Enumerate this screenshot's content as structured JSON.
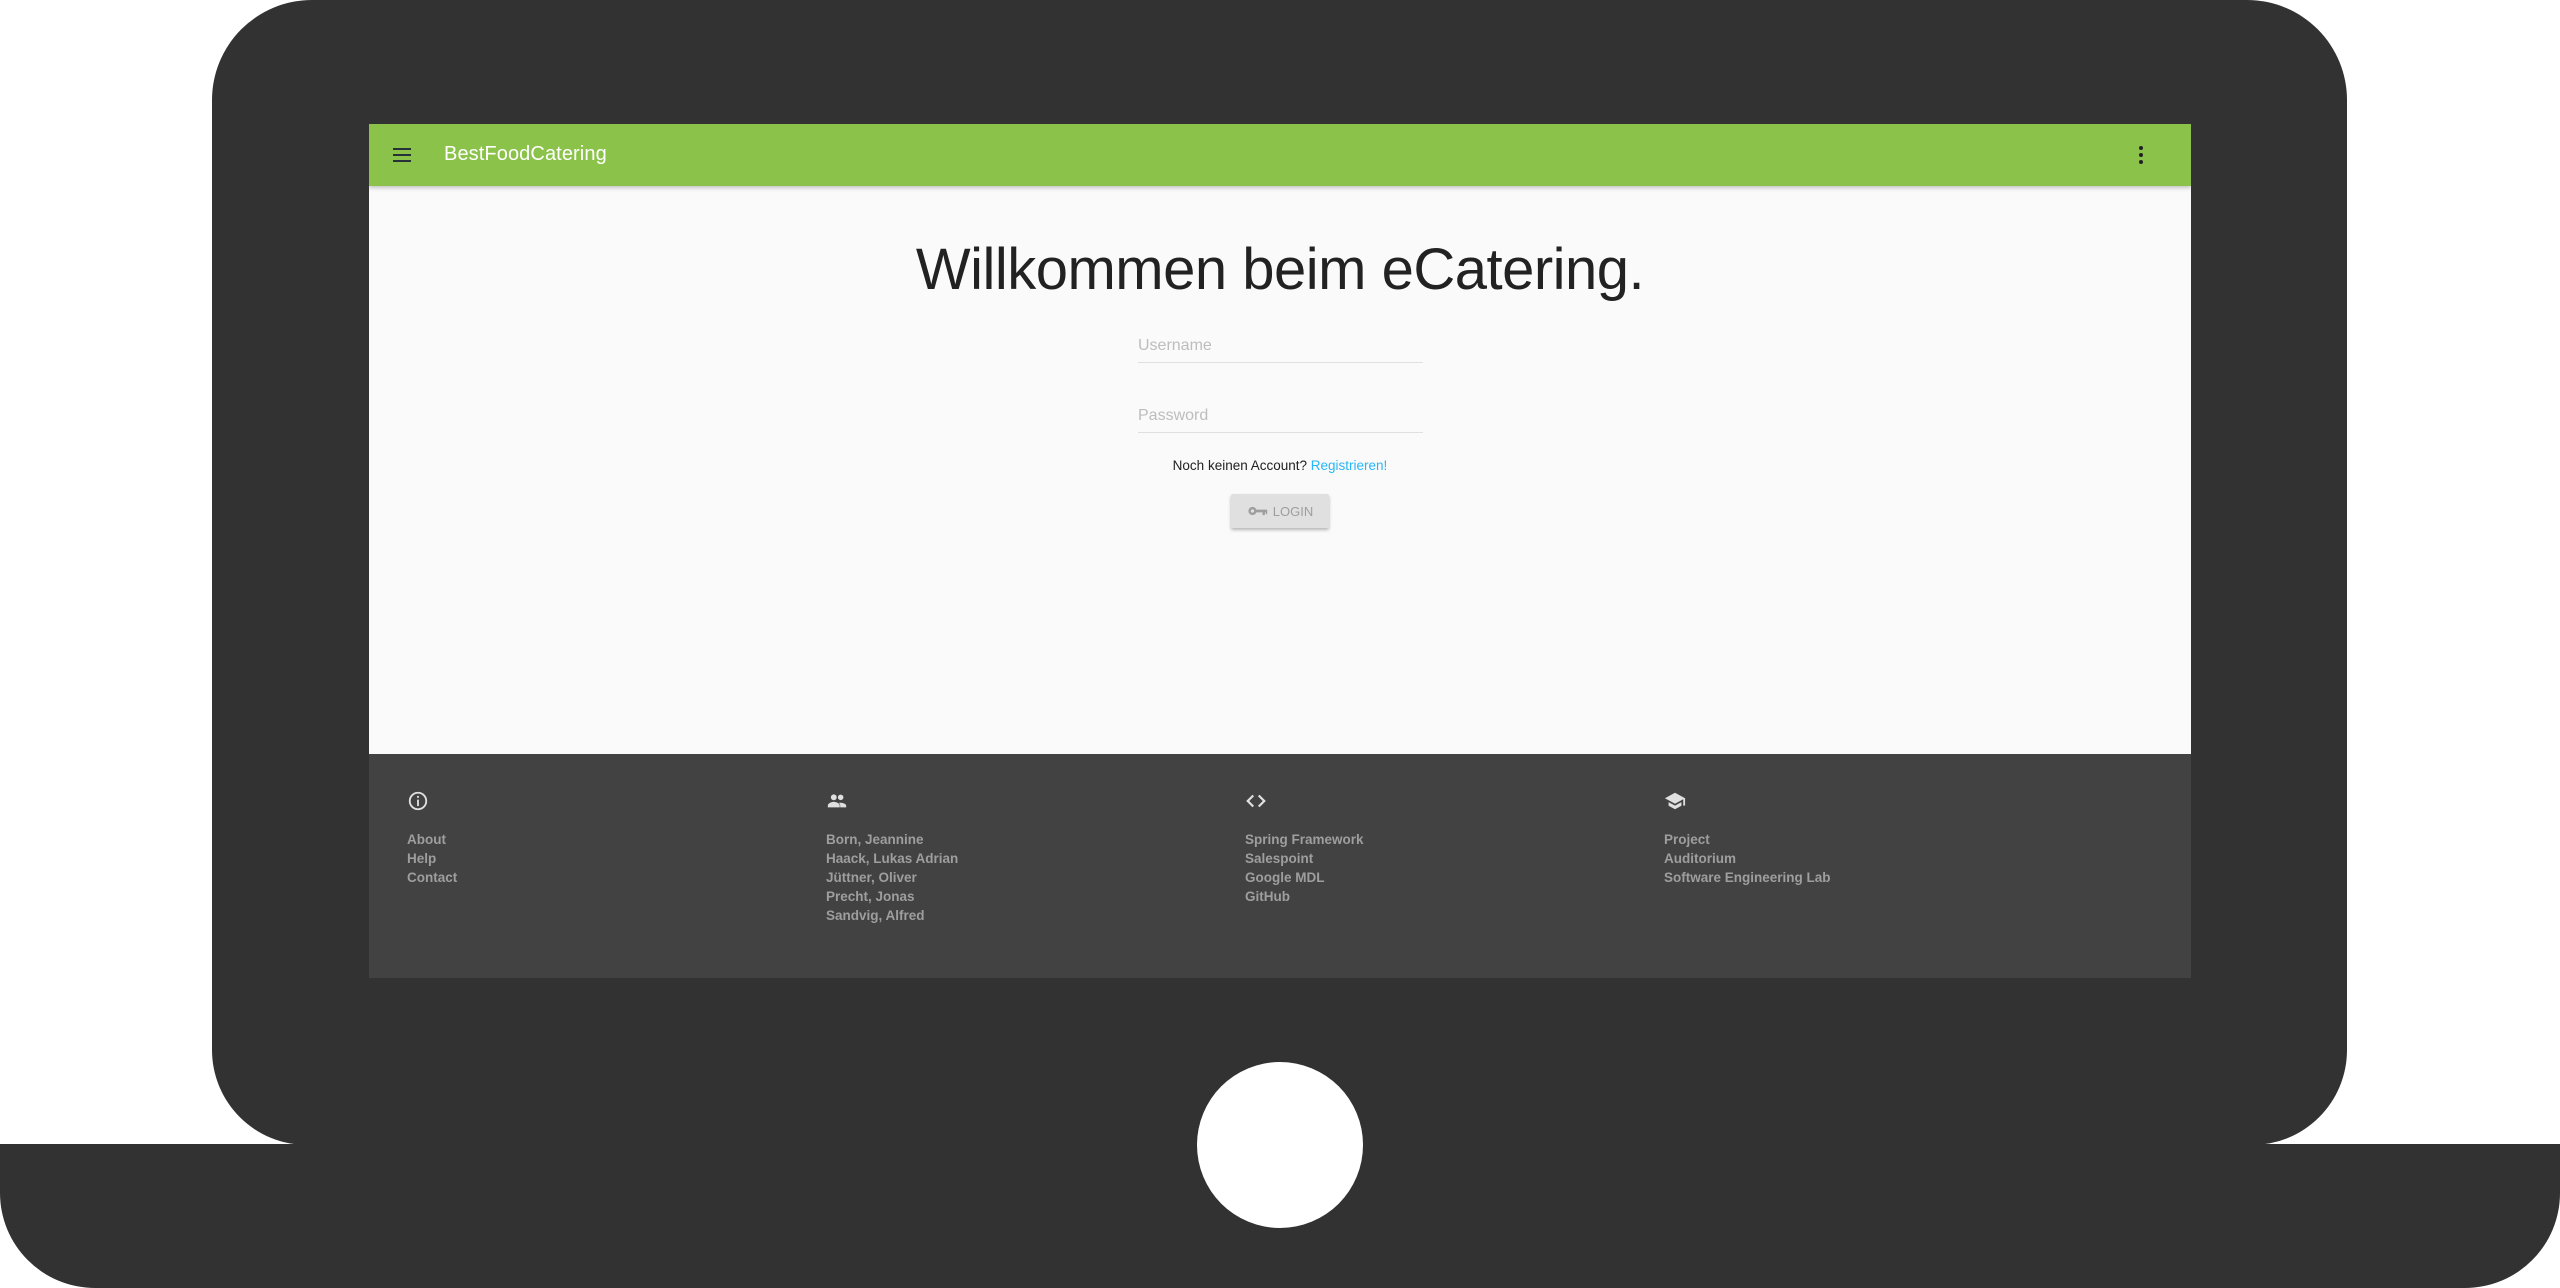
{
  "app": {
    "title": "BestFoodCatering"
  },
  "main": {
    "heading": "Willkommen beim eCatering.",
    "username_placeholder": "Username",
    "password_placeholder": "Password",
    "no_account_text": "Noch keinen Account?",
    "register_link": "Registrieren!",
    "login_label": "LOGIN"
  },
  "footer": {
    "columns": [
      {
        "icon": "info-icon",
        "links": [
          "About",
          "Help",
          "Contact"
        ]
      },
      {
        "icon": "people-icon",
        "links": [
          "Born, Jeannine",
          "Haack, Lukas Adrian",
          "Jüttner, Oliver",
          "Precht, Jonas",
          "Sandvig, Alfred"
        ]
      },
      {
        "icon": "code-icon",
        "links": [
          "Spring Framework",
          "Salespoint",
          "Google MDL",
          "GitHub"
        ]
      },
      {
        "icon": "school-icon",
        "links": [
          "Project",
          "Auditorium",
          "Software Engineering Lab"
        ]
      }
    ]
  },
  "colors": {
    "appbar": "#8bc34a",
    "link": "#29b6f6",
    "footer": "#424242",
    "frame": "#323232"
  }
}
